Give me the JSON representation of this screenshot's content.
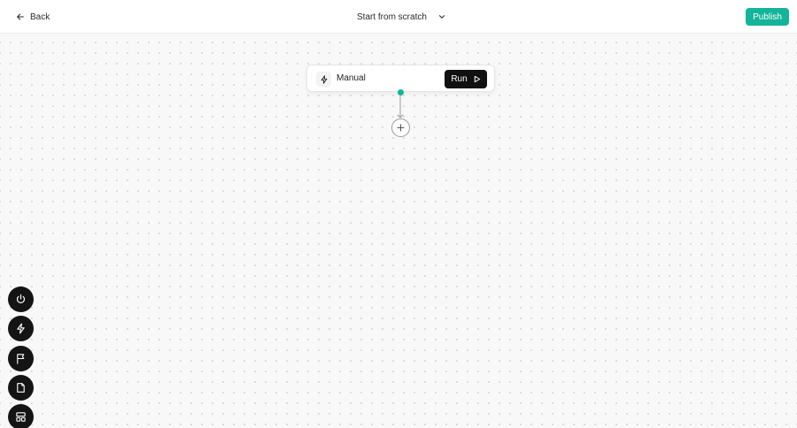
{
  "header": {
    "back_label": "Back",
    "template_label": "Start from scratch",
    "publish_label": "Publish"
  },
  "canvas": {
    "trigger_node": {
      "label": "Manual",
      "run_label": "Run"
    }
  },
  "toolbar": {
    "tools": [
      "power-icon",
      "lightning-icon",
      "flag-icon",
      "file-icon",
      "layout-icon"
    ]
  },
  "colors": {
    "accent": "#13b49a",
    "dark": "#141414",
    "canvas_bg": "#f8f8f8"
  }
}
